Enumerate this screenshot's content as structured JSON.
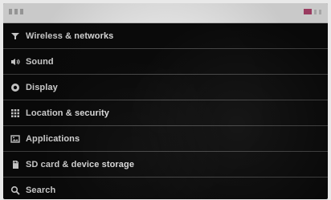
{
  "menu": {
    "items": [
      {
        "label": "Wireless & networks",
        "icon": "wifi-icon"
      },
      {
        "label": "Sound",
        "icon": "sound-icon"
      },
      {
        "label": "Display",
        "icon": "display-icon"
      },
      {
        "label": "Location & security",
        "icon": "location-security-icon"
      },
      {
        "label": "Applications",
        "icon": "applications-icon"
      },
      {
        "label": "SD card & device storage",
        "icon": "storage-icon"
      },
      {
        "label": "Search",
        "icon": "search-icon"
      }
    ]
  }
}
